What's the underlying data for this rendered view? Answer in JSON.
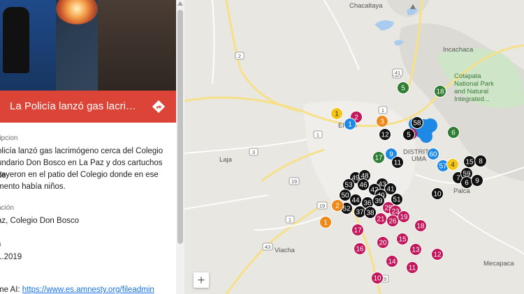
{
  "panel": {
    "title": "La Policía lanzó gas lacri…",
    "description_label": "ripcion",
    "description_lines": [
      "olicía lanzó gas lacrimógeno cerca del Colegio",
      "undario Don Bosco en La Paz y dos cartuchos de",
      "cayeron en el patio del Colegio donde en ese",
      "mento había niños."
    ],
    "location_label": "ación",
    "location_value": "az, Colegio Don Bosco",
    "date_label": "a",
    "date_value": "1.2019",
    "source_prefix": "me AI: ",
    "source_link": "https://www.es.amnesty.org/fileadmin"
  },
  "map": {
    "zoom_in_label": "+",
    "places": {
      "chacaltaya": "Chacaltaya",
      "incachaca": "Incachaca",
      "cotapata_1": "Cotapata",
      "cotapata_2": "National Park",
      "cotapata_3": "and Natural",
      "cotapata_4": "Integrated...",
      "el_alto": "El Alto",
      "distrito_1": "DISTRITO",
      "distrito_2": "UMA",
      "laja": "Laja",
      "viacha": "Viacha",
      "mecapaca": "Mecapaca",
      "palca": "Palca"
    },
    "roads": [
      "2",
      "1",
      "2",
      "41",
      "3",
      "1",
      "19",
      "19",
      "43",
      "1",
      "19"
    ],
    "colors": {
      "black": "#111111",
      "magenta": "#c2185b",
      "blue": "#1e88e5",
      "orange": "#ef8a1a",
      "yellow": "#f5c518",
      "green": "#2e7d32",
      "red_bar": "#db4437"
    },
    "markers": [
      {
        "label": "5",
        "color": "green"
      },
      {
        "label": "18",
        "color": "green"
      },
      {
        "label": "6",
        "color": "green"
      },
      {
        "label": "1",
        "color": "yellow"
      },
      {
        "label": "2",
        "color": "magenta"
      },
      {
        "label": "1",
        "color": "blue"
      },
      {
        "label": "3",
        "color": "orange"
      },
      {
        "label": "58",
        "color": "black"
      },
      {
        "label": "5",
        "color": "black"
      },
      {
        "label": "12",
        "color": "black"
      },
      {
        "label": "9",
        "color": "blue"
      },
      {
        "label": "17",
        "color": "green"
      },
      {
        "label": "11",
        "color": "black"
      },
      {
        "label": "60",
        "color": "blue"
      },
      {
        "label": "57",
        "color": "blue"
      },
      {
        "label": "4",
        "color": "yellow"
      },
      {
        "label": "15",
        "color": "black"
      },
      {
        "label": "8",
        "color": "black"
      },
      {
        "label": "7",
        "color": "black"
      },
      {
        "label": "59",
        "color": "black"
      },
      {
        "label": "6",
        "color": "black"
      },
      {
        "label": "9",
        "color": "black"
      },
      {
        "label": "10",
        "color": "black"
      },
      {
        "label": "49",
        "color": "black"
      },
      {
        "label": "48",
        "color": "black"
      },
      {
        "label": "53",
        "color": "black"
      },
      {
        "label": "46",
        "color": "black"
      },
      {
        "label": "43",
        "color": "black"
      },
      {
        "label": "42",
        "color": "black"
      },
      {
        "label": "41",
        "color": "black"
      },
      {
        "label": "50",
        "color": "black"
      },
      {
        "label": "40",
        "color": "black"
      },
      {
        "label": "44",
        "color": "black"
      },
      {
        "label": "36",
        "color": "black"
      },
      {
        "label": "39",
        "color": "black"
      },
      {
        "label": "51",
        "color": "black"
      },
      {
        "label": "52",
        "color": "black"
      },
      {
        "label": "37",
        "color": "black"
      },
      {
        "label": "38",
        "color": "black"
      },
      {
        "label": "2",
        "color": "orange"
      },
      {
        "label": "1",
        "color": "orange"
      },
      {
        "label": "25",
        "color": "magenta"
      },
      {
        "label": "23",
        "color": "magenta"
      },
      {
        "label": "21",
        "color": "magenta"
      },
      {
        "label": "26",
        "color": "magenta"
      },
      {
        "label": "19",
        "color": "magenta"
      },
      {
        "label": "18",
        "color": "magenta"
      },
      {
        "label": "17",
        "color": "magenta"
      },
      {
        "label": "15",
        "color": "magenta"
      },
      {
        "label": "20",
        "color": "magenta"
      },
      {
        "label": "13",
        "color": "magenta"
      },
      {
        "label": "16",
        "color": "magenta"
      },
      {
        "label": "12",
        "color": "magenta"
      },
      {
        "label": "14",
        "color": "magenta"
      },
      {
        "label": "11",
        "color": "magenta"
      },
      {
        "label": "10",
        "color": "magenta"
      }
    ]
  }
}
